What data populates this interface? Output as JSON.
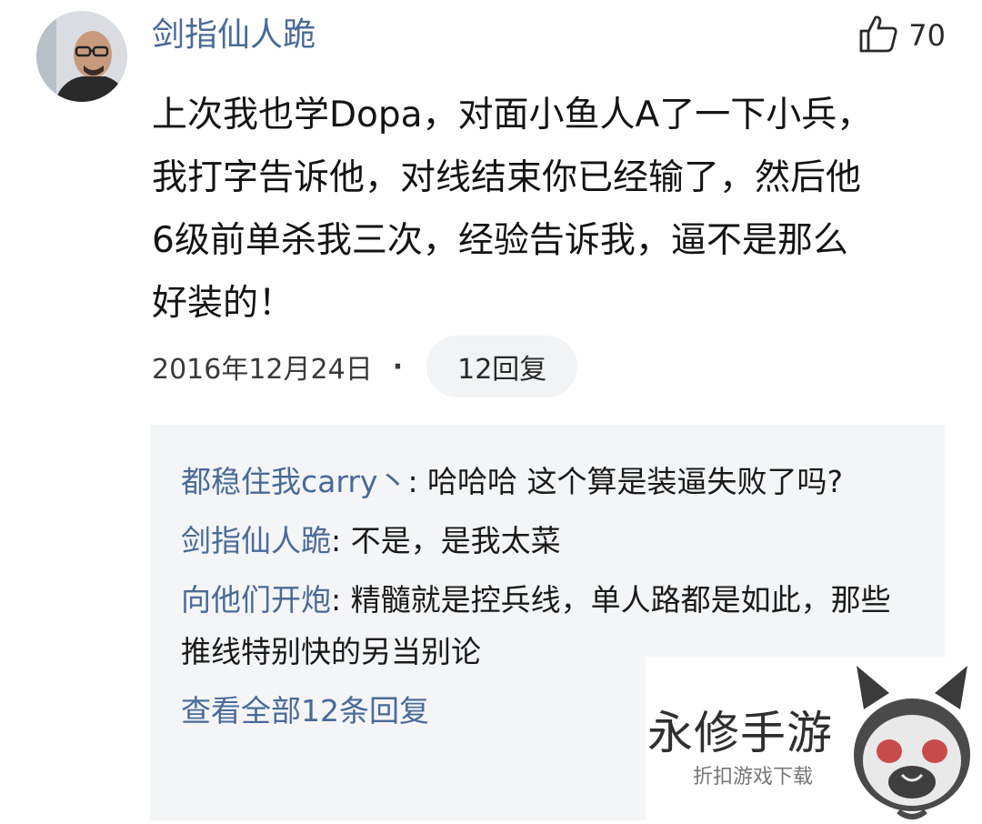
{
  "comment": {
    "username": "剑指仙人跪",
    "likes": "70",
    "content": "上次我也学Dopa，对面小鱼人A了一下小兵，\n我打字告诉他，对线结束你已经输了，然后他\n6级前单杀我三次，经验告诉我，逼不是那么\n好装的！",
    "date": "2016年12月24日",
    "separator": "·",
    "reply_button": "12回复"
  },
  "replies": {
    "items": [
      {
        "name": "都稳住我carry丶",
        "text": ": 哈哈哈 这个算是装逼失败了吗?"
      },
      {
        "name": "剑指仙人跪",
        "text": ": 不是，是我太菜"
      },
      {
        "name": "向他们开炮",
        "text": ": 精髓就是控兵线，单人路都是如此，那些推线特别快的另当别论"
      }
    ],
    "view_all": "查看全部12条回复"
  },
  "watermark": {
    "title": "永修手游",
    "subtitle": "折扣游戏下载"
  },
  "icons": {
    "like": "thumbs-up-icon",
    "logo": "mascot-logo-icon"
  },
  "colors": {
    "username": "#4a6a97",
    "reply_panel_bg": "#f4f5f7"
  }
}
